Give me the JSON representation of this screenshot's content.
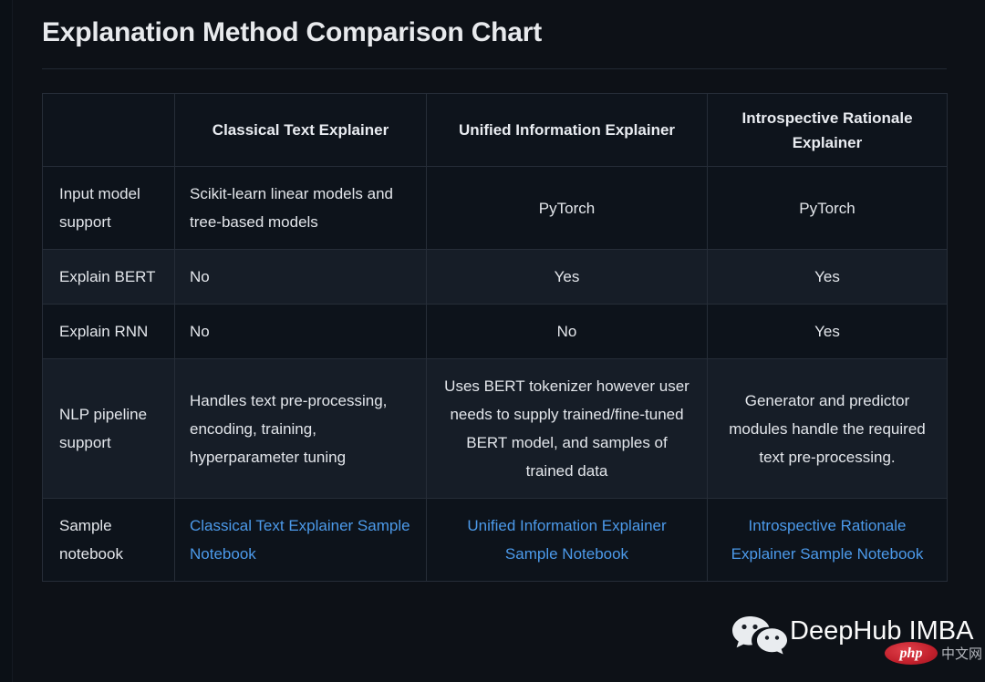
{
  "page": {
    "title": "Explanation Method Comparison Chart",
    "background_color": "#0d1117",
    "link_color": "#4c9aea",
    "text_color": "#e3e6eb"
  },
  "table": {
    "headers": [
      "",
      "Classical Text Explainer",
      "Unified Information Explainer",
      "Introspective Rationale Explainer"
    ],
    "rows": [
      {
        "label": "Input model support",
        "cells": [
          "Scikit-learn linear models and tree-based models",
          "PyTorch",
          "PyTorch"
        ],
        "align": [
          "left",
          "center",
          "center"
        ],
        "links": [
          false,
          false,
          false
        ]
      },
      {
        "label": "Explain BERT",
        "cells": [
          "No",
          "Yes",
          "Yes"
        ],
        "align": [
          "left",
          "center",
          "center"
        ],
        "links": [
          false,
          false,
          false
        ]
      },
      {
        "label": "Explain RNN",
        "cells": [
          "No",
          "No",
          "Yes"
        ],
        "align": [
          "left",
          "center",
          "center"
        ],
        "links": [
          false,
          false,
          false
        ]
      },
      {
        "label": "NLP pipeline support",
        "cells": [
          "Handles text pre-processing, encoding, training, hyperparameter tuning",
          "Uses BERT tokenizer however user needs to supply trained/fine-tuned BERT model, and samples of trained data",
          "Generator and predictor modules handle the required text pre-processing."
        ],
        "align": [
          "left",
          "center",
          "center"
        ],
        "links": [
          false,
          false,
          false
        ]
      },
      {
        "label": "Sample notebook",
        "cells": [
          "Classical Text Explainer Sample Notebook",
          "Unified Information Explainer Sample Notebook",
          "Introspective Rationale Explainer Sample Notebook"
        ],
        "align": [
          "left",
          "center",
          "center"
        ],
        "links": [
          true,
          true,
          true
        ]
      }
    ]
  },
  "watermark": {
    "logo": "wechat-icon",
    "text": "DeepHub IMBA",
    "badge_text": "php",
    "badge_suffix": "中文网",
    "badge_color": "#c2202c"
  }
}
